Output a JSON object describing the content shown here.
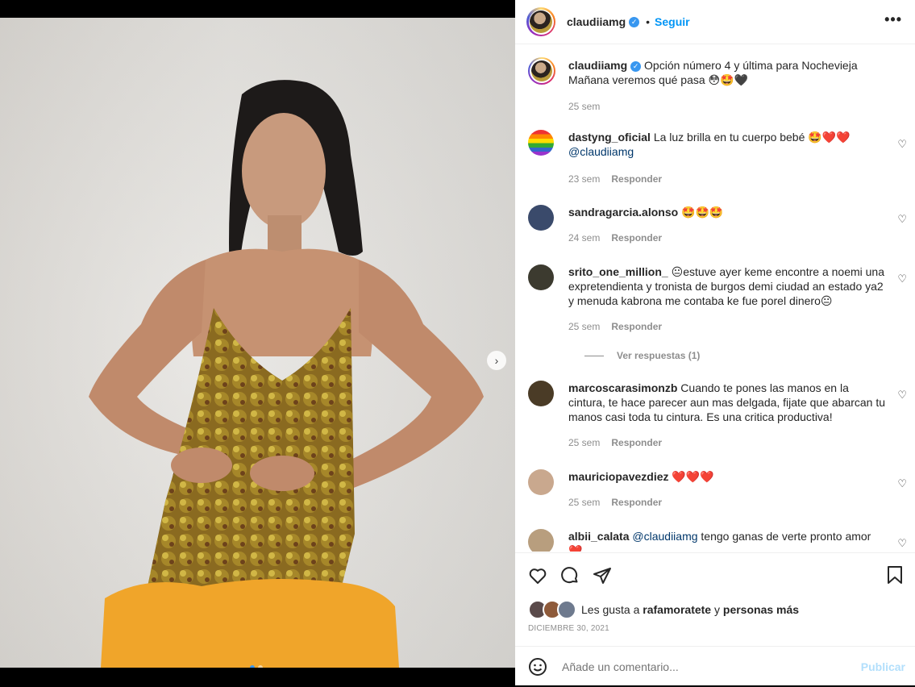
{
  "post": {
    "username": "claudiiamg",
    "follow_label": "Seguir",
    "separator": "•",
    "more_label": "•••",
    "next_label": "›"
  },
  "caption": {
    "username": "claudiiamg",
    "line1": "Opción número 4 y última para Nochevieja",
    "line2": "Mañana veremos qué pasa 😳🤩🖤",
    "time": "25 sem"
  },
  "comments": [
    {
      "username": "dastyng_oficial",
      "text": "La luz brilla en tu cuerpo bebé 🤩❤️❤️",
      "mention": "@claudiiamg",
      "time": "23 sem",
      "reply": "Responder",
      "avatar_color": "#d23b3b"
    },
    {
      "username": "sandragarcia.alonso",
      "text": "🤩🤩🤩",
      "time": "24 sem",
      "reply": "Responder",
      "avatar_color": "#3a4a6b"
    },
    {
      "username": "srito_one_million_",
      "text": "😐estuve ayer keme encontre a noemi una expretendienta y tronista de burgos demi ciudad an estado ya2 y menuda kabrona me contaba ke fue porel dinero😐",
      "time": "25 sem",
      "reply": "Responder",
      "avatar_color": "#3c3a2f",
      "more_replies": "Ver respuestas (1)"
    },
    {
      "username": "marcoscarasimonzb",
      "text": "Cuando te pones las manos en la cintura, te hace parecer aun mas delgada, fijate que abarcan tu manos casi toda tu cintura. Es una critica productiva!",
      "time": "25 sem",
      "reply": "Responder",
      "avatar_color": "#4a3b26"
    },
    {
      "username": "mauriciopavezdiez",
      "text": "❤️❤️❤️",
      "time": "25 sem",
      "reply": "Responder",
      "avatar_color": "#c9a88e"
    },
    {
      "username": "albii_calata",
      "text": "tengo ganas de verte pronto amor",
      "mention": "@claudiiamg",
      "extra": "❤️",
      "avatar_color": "#b89e7e"
    }
  ],
  "actions": {
    "likes_prefix": "Les gusta a",
    "likes_user": "rafamoratete",
    "likes_and": "y",
    "likes_rest": "personas más",
    "date": "DICIEMBRE 30, 2021",
    "comment_placeholder": "Añade un comentario...",
    "publish_label": "Publicar"
  },
  "colors": {
    "accent": "#0095f6",
    "verified": "#3897f0",
    "muted": "#8e8e8e",
    "publish_disabled": "#b2dffc"
  },
  "icons": [
    "verified-icon",
    "more-options-icon",
    "next-arrow-icon",
    "heart-icon",
    "comment-icon",
    "share-icon",
    "bookmark-icon",
    "emoji-icon"
  ]
}
